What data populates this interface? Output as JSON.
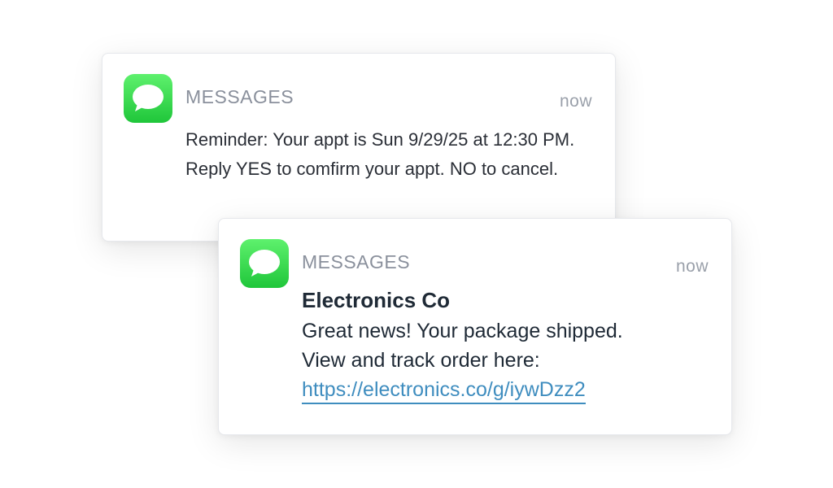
{
  "notifications": [
    {
      "app_name": "MESSAGES",
      "time": "now",
      "icon": "messages-icon",
      "body": "Reminder: Your appt is Sun 9/29/25 at 12:30 PM. Reply YES to comfirm your appt. NO to cancel."
    },
    {
      "app_name": "MESSAGES",
      "time": "now",
      "icon": "messages-icon",
      "sender": "Electronics Co",
      "body_line_1": "Great news! Your package shipped.",
      "body_line_2": "View and track order here:",
      "link": "https://electronics.co/g/iywDzz2"
    }
  ],
  "colors": {
    "icon_green": "#34d34f",
    "link": "#3f8dbf",
    "app_name": "#8a909c",
    "text": "#1f2a36"
  }
}
